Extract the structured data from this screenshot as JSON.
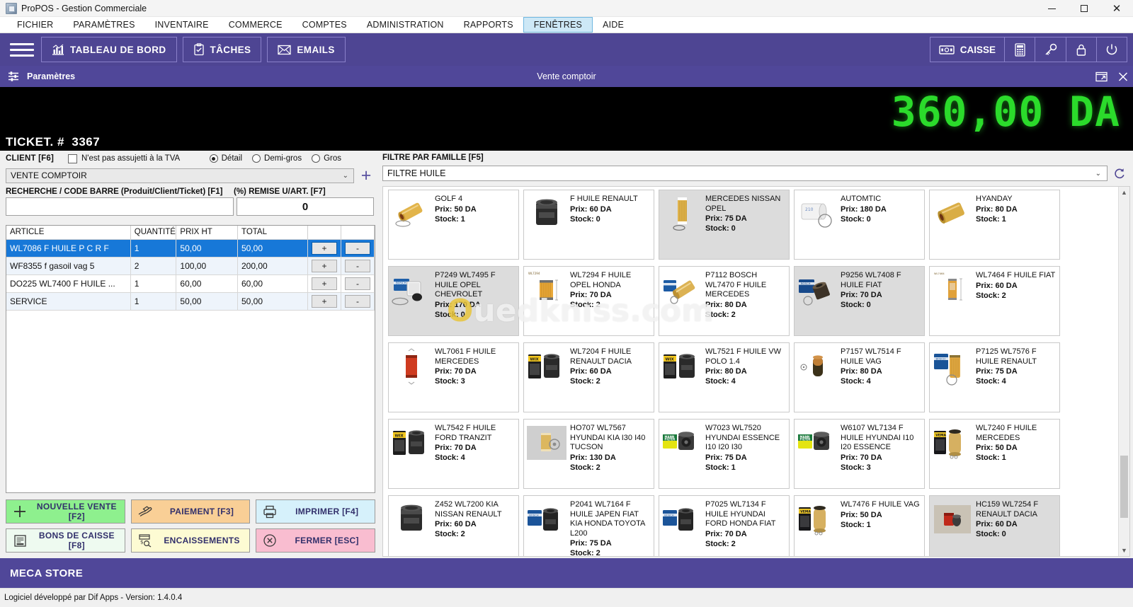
{
  "window": {
    "title": "ProPOS - Gestion Commerciale",
    "minimize": "—",
    "maximize": "❐",
    "close": "✕"
  },
  "menubar": {
    "items": [
      {
        "label": "FICHIER",
        "active": false
      },
      {
        "label": "PARAMÈTRES",
        "active": false
      },
      {
        "label": "INVENTAIRE",
        "active": false
      },
      {
        "label": "COMMERCE",
        "active": false
      },
      {
        "label": "COMPTES",
        "active": false
      },
      {
        "label": "ADMINISTRATION",
        "active": false
      },
      {
        "label": "RAPPORTS",
        "active": false
      },
      {
        "label": "FENÊTRES",
        "active": true
      },
      {
        "label": "AIDE",
        "active": false
      }
    ]
  },
  "toolbar": {
    "dashboard": "TABLEAU DE BORD",
    "tasks": "TÂCHES",
    "emails": "EMAILS",
    "caisse": "CAISSE",
    "accent": "#4e4593"
  },
  "subheader": {
    "left_label": "Paramètres",
    "center_label": "Vente comptoir"
  },
  "display": {
    "total": "360,00 DA",
    "total_color": "#2bdb2b",
    "ticket_label": "TICKET. #",
    "ticket_number": "3367"
  },
  "left_panel": {
    "client_label": "CLIENT [F6]",
    "tva_checkbox_label": "N'est pas assujetti à la TVA",
    "tva_checked": false,
    "price_modes": [
      {
        "label": "Détail",
        "selected": true
      },
      {
        "label": "Demi-gros",
        "selected": false
      },
      {
        "label": "Gros",
        "selected": false
      }
    ],
    "client_select_value": "VENTE COMPTOIR",
    "search_label": "RECHERCHE / CODE BARRE (Produit/Client/Ticket) [F1]",
    "search_value": "",
    "remise_label": "(%) REMISE U/ART. [F7]",
    "remise_value": "0",
    "table": {
      "headers": [
        "ARTICLE",
        "QUANTITÉ",
        "PRIX HT",
        "TOTAL",
        "",
        ""
      ],
      "plus_label": "+",
      "minus_label": "-",
      "rows": [
        {
          "article": "WL7086 F HUILE P C R F",
          "qty": "1",
          "prix_ht": "50,00",
          "total": "50,00",
          "selected": true
        },
        {
          "article": "WF8355 f gasoil vag 5",
          "qty": "2",
          "prix_ht": "100,00",
          "total": "200,00",
          "selected": false
        },
        {
          "article": "DO225 WL7400 F HUILE ...",
          "qty": "1",
          "prix_ht": "60,00",
          "total": "60,00",
          "selected": false
        },
        {
          "article": "SERVICE",
          "qty": "1",
          "prix_ht": "50,00",
          "total": "50,00",
          "selected": false
        }
      ]
    },
    "actions": [
      {
        "label": "NOUVELLE VENTE [F2]",
        "color": "bg-green",
        "icon": "plus-icon"
      },
      {
        "label": "PAIEMENT [F3]",
        "color": "bg-orange",
        "icon": "cash-hand-icon"
      },
      {
        "label": "IMPRIMER [F4]",
        "color": "bg-cyan",
        "icon": "printer-icon"
      },
      {
        "label": "BONS DE CAISSE [F8]",
        "color": "bg-mint",
        "icon": "receipt-icon"
      },
      {
        "label": "ENCAISSEMENTS",
        "color": "bg-yellow",
        "icon": "money-search-icon"
      },
      {
        "label": "FERMER [ESC]",
        "color": "bg-pink",
        "icon": "close-circle-icon"
      }
    ]
  },
  "right_panel": {
    "family_label": "FILTRE PAR FAMILLE [F5]",
    "family_value": "FILTRE HUILE",
    "price_prefix": "Prix:",
    "stock_prefix": "Stock:",
    "products": [
      {
        "name": "GOLF 4",
        "price": "50 DA",
        "stock": "1",
        "oos": false,
        "img": "oil-filter-gold-cylinder"
      },
      {
        "name": "F HUILE RENAULT",
        "price": "60 DA",
        "stock": "0",
        "oos": false,
        "img": "spin-on-black"
      },
      {
        "name": "MERCEDES NISSAN OPEL",
        "price": "75 DA",
        "stock": "0",
        "oos": true,
        "img": "tall-gold-cartridge"
      },
      {
        "name": "AUTOMTIC",
        "price": "180 DA",
        "stock": "0",
        "oos": false,
        "img": "white-box-filter"
      },
      {
        "name": "HYANDAY",
        "price": "80 DA",
        "stock": "1",
        "oos": false,
        "img": "gold-roll-filter"
      },
      {
        "name": "P7249 WL7495 F HUILE OPEL CHEVROLET",
        "price": "170 DA",
        "stock": "0",
        "oos": true,
        "img": "bosch-box-white"
      },
      {
        "name": "WL7294 F HUILE OPEL HONDA",
        "price": "70 DA",
        "stock": "2",
        "oos": false,
        "img": "orange-cartridge-diag"
      },
      {
        "name": "P7112 BOSCH WL7470 F HUILE MERCEDES",
        "price": "80 DA",
        "stock": "2",
        "oos": false,
        "img": "bosch-blue-gold"
      },
      {
        "name": "P9256 WL7408 F HUILE FIAT",
        "price": "70 DA",
        "stock": "0",
        "oos": true,
        "img": "bosch-box-dark"
      },
      {
        "name": "WL7464 F HUILE FIAT",
        "price": "60 DA",
        "stock": "2",
        "oos": false,
        "img": "slim-orange-cartridge"
      },
      {
        "name": "WL7061 F HUILE MERCEDES",
        "price": "70 DA",
        "stock": "3",
        "oos": false,
        "img": "red-cartridge"
      },
      {
        "name": "WL7204 F HUILE RENAULT DACIA",
        "price": "60 DA",
        "stock": "2",
        "oos": false,
        "img": "wix-box-black"
      },
      {
        "name": "WL7521 F HUILE VW POLO 1.4",
        "price": "80 DA",
        "stock": "4",
        "oos": false,
        "img": "wix-box-black"
      },
      {
        "name": "P7157 WL7514 F HUILE VAG",
        "price": "80 DA",
        "stock": "4",
        "oos": false,
        "img": "small-dark-cartridge"
      },
      {
        "name": "P7125 WL7576 F HUILE RENAULT",
        "price": "75 DA",
        "stock": "4",
        "oos": false,
        "img": "bosch-blue-orange"
      },
      {
        "name": "WL7542 F HUILE FORD TRANZIT",
        "price": "70 DA",
        "stock": "4",
        "oos": false,
        "img": "wix-box-black"
      },
      {
        "name": "HO707 WL7567 HYUNDAI KIA I30 I40 TUCSON",
        "price": "130 DA",
        "stock": "2",
        "oos": false,
        "img": "gray-gold-cartridge"
      },
      {
        "name": "W7023 WL7520 HYUNDAI ESSENCE I10 I20 I30",
        "price": "75 DA",
        "stock": "1",
        "oos": false,
        "img": "mann-filter-green"
      },
      {
        "name": "W6107 WL7134 F HUILE HYUNDAI I10 I20 ESSENCE",
        "price": "70 DA",
        "stock": "3",
        "oos": false,
        "img": "mann-filter-green"
      },
      {
        "name": "WL7240 F HUILE MERCEDES",
        "price": "50 DA",
        "stock": "1",
        "oos": false,
        "img": "vema-box-gold"
      },
      {
        "name": "Z452 WL7200 KIA NISSAN RENAULT",
        "price": "60 DA",
        "stock": "2",
        "oos": false,
        "img": "spin-on-black"
      },
      {
        "name": "P2041 WL7164 F HUILE JAPEN FIAT KIA HONDA TOYOTA L200",
        "price": "75 DA",
        "stock": "2",
        "oos": false,
        "img": "bosch-blue-black"
      },
      {
        "name": "P7025 WL7134 F HUILE HYUNDAI FORD HONDA FIAT",
        "price": "70 DA",
        "stock": "2",
        "oos": false,
        "img": "bosch-blue-black"
      },
      {
        "name": "WL7476 F HUILE VAG",
        "price": "50 DA",
        "stock": "1",
        "oos": false,
        "img": "vema-box-gold"
      },
      {
        "name": "HC159 WL7254 F RENAULT DACIA",
        "price": "60 DA",
        "stock": "0",
        "oos": true,
        "img": "red-small-filter"
      }
    ],
    "watermark_part1": "O",
    "watermark_part2": "uedkniss.com"
  },
  "footer": {
    "store_name": "MECA STORE",
    "status": "Logiciel développé par Dif Apps - Version:  1.4.0.4"
  }
}
